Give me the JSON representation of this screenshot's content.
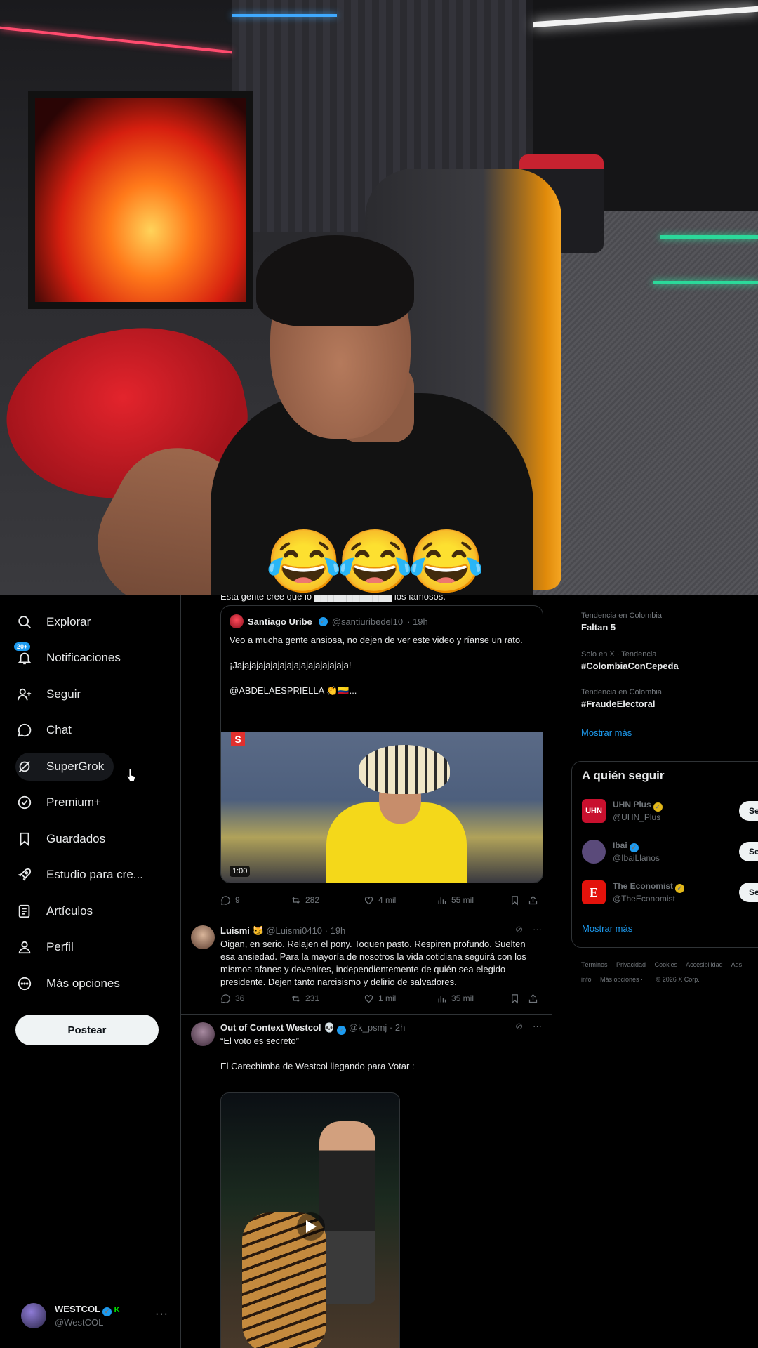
{
  "overlay": {
    "emojis": "😂😂😂"
  },
  "nav": {
    "items": [
      {
        "label": "Explorar"
      },
      {
        "label": "Notificaciones",
        "badge": "20+"
      },
      {
        "label": "Seguir"
      },
      {
        "label": "Chat"
      },
      {
        "label": "SuperGrok"
      },
      {
        "label": "Premium+"
      },
      {
        "label": "Guardados"
      },
      {
        "label": "Estudio para cre..."
      },
      {
        "label": "Artículos"
      },
      {
        "label": "Perfil"
      },
      {
        "label": "Más opciones"
      }
    ],
    "post_button": "Postear",
    "account": {
      "name": "WESTCOL",
      "handle": "@WestCOL",
      "badge": "K",
      "more": "···"
    }
  },
  "feed": {
    "cut_text": "Esta gente cree que lo ████████████ los famosos.",
    "quote": {
      "name": "Santiago Uribe",
      "handle": "@santiuribedel10",
      "time": "· 19h",
      "text": "Veo a mucha gente ansiosa, no dejen de ver este video y ríanse un rato.\n\n¡Jajajajajajajajajajajajajajajaja!\n\n@ABDELAESPRIELLA 👏🇨🇴...",
      "video_duration": "1:00",
      "media_logo": "S"
    },
    "stats1": {
      "replies": "9",
      "reposts": "282",
      "likes": "4 mil",
      "views": "55 mil"
    },
    "tweet2": {
      "name": "Luismi",
      "emoji": "😼",
      "handle": "@Luismi0410",
      "time": "· 19h",
      "text": "Oigan, en serio. Relajen el pony. Toquen pasto. Respiren profundo. Suelten esa ansiedad. Para la mayoría de nosotros la vida cotidiana seguirá con los mismos afanes y devenires, independientemente de quién sea elegido presidente. Dejen tanto narcisismo y delirio de salvadores.",
      "replies": "36",
      "reposts": "231",
      "likes": "1 mil",
      "views": "35 mil"
    },
    "tweet3": {
      "name": "Out of Context Westcol",
      "emoji": "💀",
      "handle": "@k_psmj",
      "time": "· 2h",
      "line1": "“El voto es secreto”",
      "line2": "El Carechimba de Westcol llegando para Votar :"
    }
  },
  "sidebar": {
    "trends": [
      {
        "context": "Tendencia en Colombia",
        "name": "Faltan 5"
      },
      {
        "context": "Solo en X · Tendencia",
        "name": "#ColombiaConCepeda"
      },
      {
        "context": "Tendencia en Colombia",
        "name": "#FraudeElectoral"
      }
    ],
    "show_more": "Mostrar más",
    "who_to_follow": {
      "title": "A quién seguir",
      "accounts": [
        {
          "name": "UHN Plus",
          "handle": "@UHN_Plus",
          "avatar_text": "UHN",
          "color": "#c8102e"
        },
        {
          "name": "Ibai",
          "handle": "@IbaiLlanos",
          "avatar_text": "",
          "color": "#5a4a7a"
        },
        {
          "name": "The Economist",
          "handle": "@TheEconomist",
          "avatar_text": "E",
          "color": "#e3120b"
        }
      ],
      "follow_label": "Segu",
      "show_more": "Mostrar más"
    },
    "footer": [
      "Términos",
      "Privacidad",
      "Cookies",
      "Accesibilidad",
      "Ads info",
      "Más opciones ···",
      "© 2026 X Corp."
    ]
  },
  "colors": {
    "accent": "#1d9bf0",
    "background": "#000000",
    "muted": "#71767b"
  }
}
